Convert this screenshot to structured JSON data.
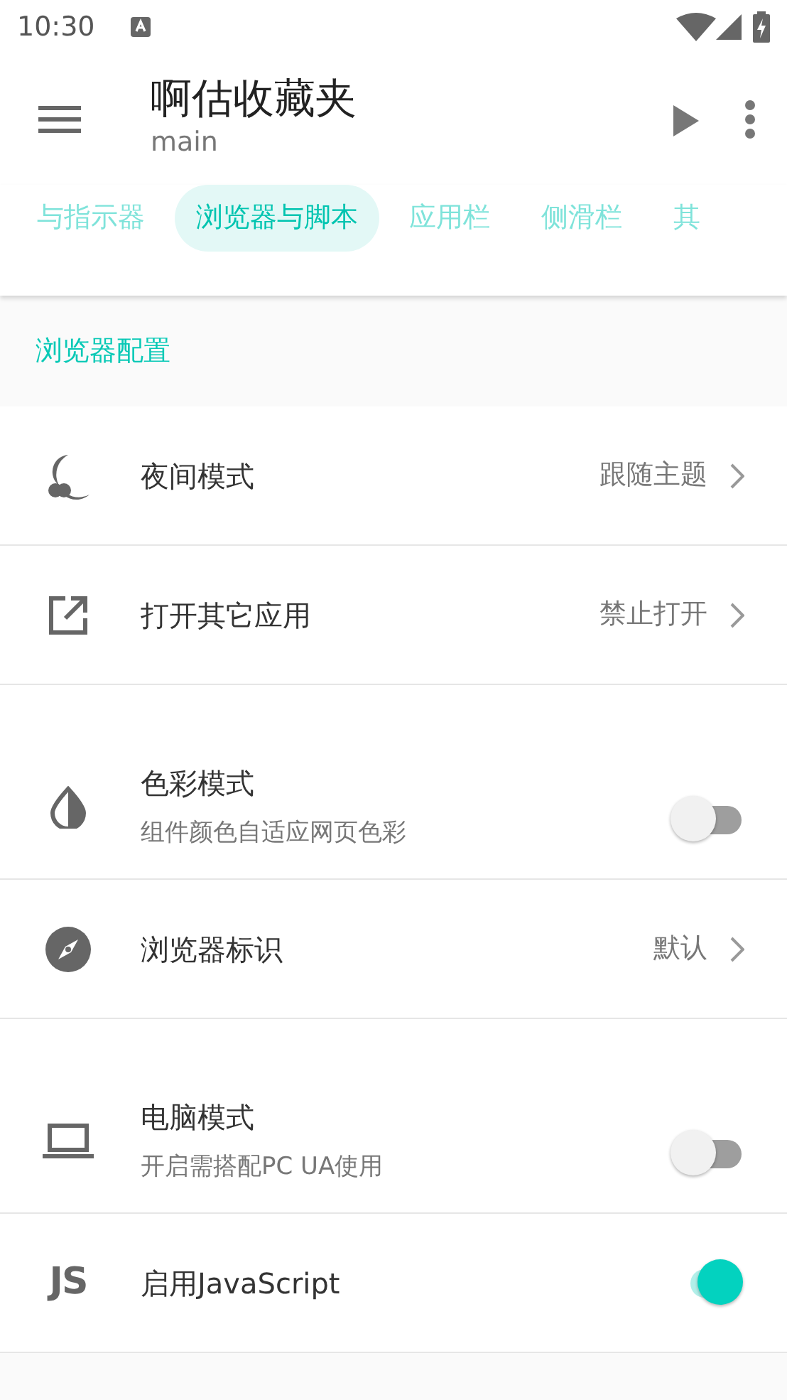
{
  "status_bar": {
    "time": "10:30"
  },
  "app_bar": {
    "title": "啊估收藏夹",
    "subtitle": "main"
  },
  "tabs": [
    {
      "label": "与指示器",
      "selected": false
    },
    {
      "label": "浏览器与脚本",
      "selected": true
    },
    {
      "label": "应用栏",
      "selected": false
    },
    {
      "label": "侧滑栏",
      "selected": false
    },
    {
      "label": "其",
      "selected": false
    }
  ],
  "section": {
    "title": "浏览器配置"
  },
  "settings": [
    {
      "kind": "value",
      "label": "夜间模式",
      "value": "跟随主题"
    },
    {
      "kind": "value",
      "label": "打开其它应用",
      "value": "禁止打开"
    },
    {
      "kind": "switch",
      "label": "色彩模式",
      "summary": "组件颜色自适应网页色彩",
      "on": false
    },
    {
      "kind": "value",
      "label": "浏览器标识",
      "value": "默认"
    },
    {
      "kind": "switch",
      "label": "电脑模式",
      "summary": "开启需搭配PC UA使用",
      "on": false
    },
    {
      "kind": "switch",
      "icon_text": "JS",
      "label": "启用JavaScript",
      "on": true
    }
  ]
}
